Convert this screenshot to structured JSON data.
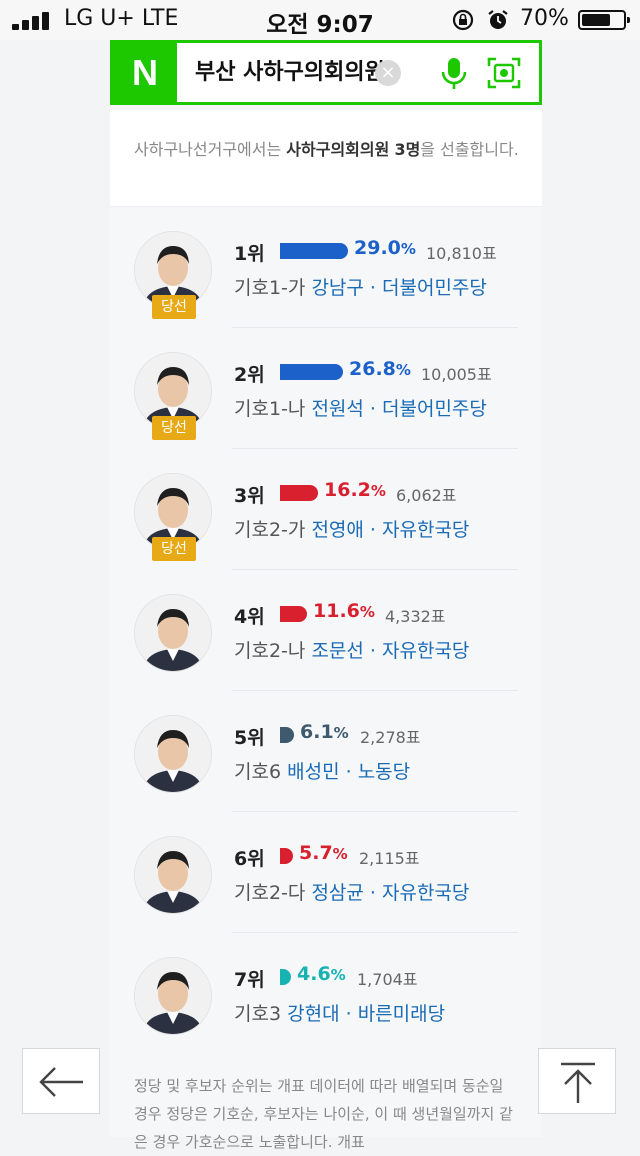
{
  "status_bar": {
    "carrier": "LG U+  LTE",
    "time": "오전 9:07",
    "battery_text": "70%",
    "battery_level": 0.7
  },
  "search": {
    "logo": "N",
    "query": "부산 사하구의회의원"
  },
  "intro": {
    "prefix": "사하구나선거구에서는 ",
    "emphasis_1": "사하구의회의원",
    "space": " ",
    "emphasis_2": "3명",
    "suffix": "을 선출합니다."
  },
  "candidates": [
    {
      "rank": "1위",
      "percent": "29.0",
      "pct_unit": "%",
      "votes": "10,810표",
      "code": "기호1-가",
      "name": "강남구",
      "dot": " · ",
      "party": "더불어민주당",
      "elected": "당선",
      "party_color": "#1b61c9",
      "share": 29.0
    },
    {
      "rank": "2위",
      "percent": "26.8",
      "pct_unit": "%",
      "votes": "10,005표",
      "code": "기호1-나",
      "name": "전원석",
      "dot": " · ",
      "party": "더불어민주당",
      "elected": "당선",
      "party_color": "#1b61c9",
      "share": 26.8
    },
    {
      "rank": "3위",
      "percent": "16.2",
      "pct_unit": "%",
      "votes": "6,062표",
      "code": "기호2-가",
      "name": "전영애",
      "dot": " · ",
      "party": "자유한국당",
      "elected": "당선",
      "party_color": "#d9202f",
      "share": 16.2
    },
    {
      "rank": "4위",
      "percent": "11.6",
      "pct_unit": "%",
      "votes": "4,332표",
      "code": "기호2-나",
      "name": "조문선",
      "dot": " · ",
      "party": "자유한국당",
      "elected": "",
      "party_color": "#d9202f",
      "share": 11.6
    },
    {
      "rank": "5위",
      "percent": "6.1",
      "pct_unit": "%",
      "votes": "2,278표",
      "code": "기호6",
      "name": "배성민",
      "dot": " · ",
      "party": "노동당",
      "elected": "",
      "party_color": "#3f5a6e",
      "share": 6.1
    },
    {
      "rank": "6위",
      "percent": "5.7",
      "pct_unit": "%",
      "votes": "2,115표",
      "code": "기호2-다",
      "name": "정삼균",
      "dot": " · ",
      "party": "자유한국당",
      "elected": "",
      "party_color": "#d9202f",
      "share": 5.7
    },
    {
      "rank": "7위",
      "percent": "4.6",
      "pct_unit": "%",
      "votes": "1,704표",
      "code": "기호3",
      "name": "강현대",
      "dot": " · ",
      "party": "바른미래당",
      "elected": "",
      "party_color": "#17b3b3",
      "share": 4.6
    }
  ],
  "footnote": "정당 및 후보자 순위는 개표 데이터에 따라 배열되며 동순일 경우 정당은 기호순, 후보자는 나이순, 이 때 생년월일까지 같은 경우 가호순으로 노출합니다. 개표"
}
